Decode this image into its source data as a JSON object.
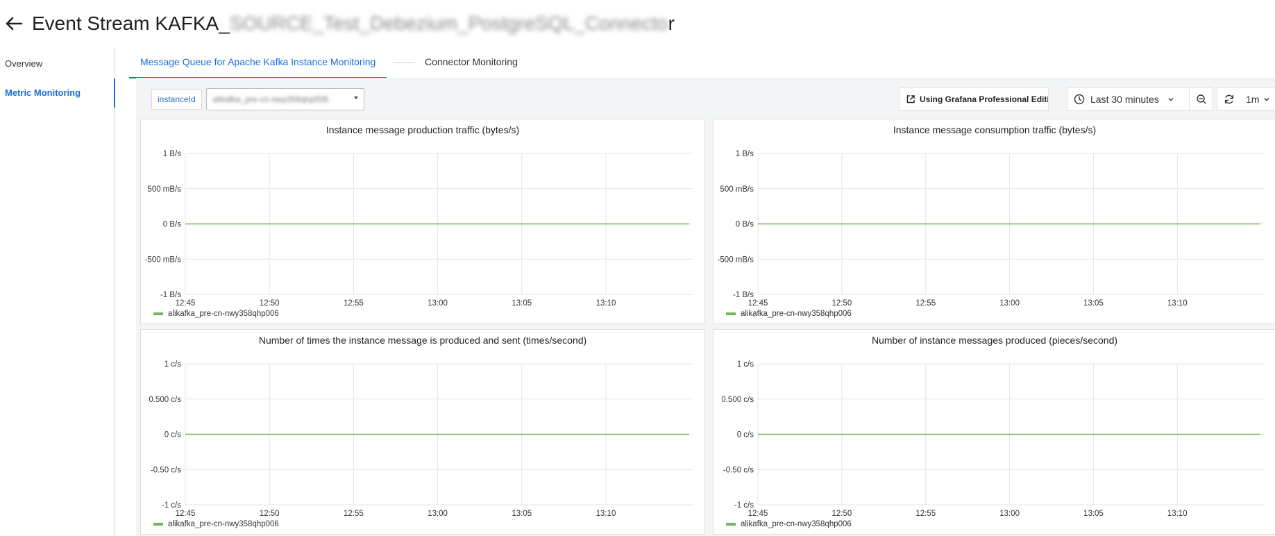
{
  "header": {
    "title_prefix": "Event Stream KAFKA_",
    "title_blurred": "SOURCE_Test_Debezium_PostgreSQL_Connecto",
    "title_suffix": "r"
  },
  "sidebar": {
    "items": [
      {
        "label": "Overview",
        "active": false
      },
      {
        "label": "Metric Monitoring",
        "active": true
      }
    ]
  },
  "tabs": [
    {
      "label": "Message Queue for Apache Kafka Instance Monitoring",
      "active": true
    },
    {
      "label": "Connector Monitoring",
      "active": false
    }
  ],
  "toolbar": {
    "variable_label": "instanceId",
    "variable_value": "alikafka_pre-cn-nwy358qhp006",
    "grafana_label": "Using Grafana Professional Edition",
    "time_range": "Last 30 minutes",
    "refresh_interval": "1m"
  },
  "colors": {
    "accent": "#1b6fd1",
    "series": "#73b359"
  },
  "icons": [
    "arrow-left-icon",
    "external-link-icon",
    "clock-icon",
    "chevron-down-icon",
    "zoom-out-icon",
    "refresh-icon"
  ],
  "chart_data": [
    {
      "type": "line",
      "title": "Instance message production traffic (bytes/s)",
      "x_ticks": [
        "12:45",
        "12:50",
        "12:55",
        "13:00",
        "13:05",
        "13:10"
      ],
      "y_ticks": [
        "1 B/s",
        "500 mB/s",
        "0 B/s",
        "-500 mB/s",
        "-1 B/s"
      ],
      "ylim": [
        -1,
        1
      ],
      "grid": true,
      "legend_position": "bottom-left",
      "series": [
        {
          "name": "alikafka_pre-cn-nwy358qhp006",
          "color": "#73b359",
          "values": [
            0,
            0,
            0,
            0,
            0,
            0,
            0
          ]
        }
      ]
    },
    {
      "type": "line",
      "title": "Instance message consumption traffic (bytes/s)",
      "x_ticks": [
        "12:45",
        "12:50",
        "12:55",
        "13:00",
        "13:05",
        "13:10"
      ],
      "y_ticks": [
        "1 B/s",
        "500 mB/s",
        "0 B/s",
        "-500 mB/s",
        "-1 B/s"
      ],
      "ylim": [
        -1,
        1
      ],
      "grid": true,
      "legend_position": "bottom-left",
      "series": [
        {
          "name": "alikafka_pre-cn-nwy358qhp006",
          "color": "#73b359",
          "values": [
            0,
            0,
            0,
            0,
            0,
            0,
            0
          ]
        }
      ]
    },
    {
      "type": "line",
      "title": "Number of times the instance message is produced and sent (times/second)",
      "x_ticks": [
        "12:45",
        "12:50",
        "12:55",
        "13:00",
        "13:05",
        "13:10"
      ],
      "y_ticks": [
        "1 c/s",
        "0.500 c/s",
        "0 c/s",
        "-0.50 c/s",
        "-1 c/s"
      ],
      "ylim": [
        -1,
        1
      ],
      "grid": true,
      "legend_position": "bottom-left",
      "series": [
        {
          "name": "alikafka_pre-cn-nwy358qhp006",
          "color": "#73b359",
          "values": [
            0,
            0,
            0,
            0,
            0,
            0,
            0
          ]
        }
      ]
    },
    {
      "type": "line",
      "title": "Number of instance messages produced (pieces/second)",
      "x_ticks": [
        "12:45",
        "12:50",
        "12:55",
        "13:00",
        "13:05",
        "13:10"
      ],
      "y_ticks": [
        "1 c/s",
        "0.500 c/s",
        "0 c/s",
        "-0.50 c/s",
        "-1 c/s"
      ],
      "ylim": [
        -1,
        1
      ],
      "grid": true,
      "legend_position": "bottom-left",
      "series": [
        {
          "name": "alikafka_pre-cn-nwy358qhp006",
          "color": "#73b359",
          "values": [
            0,
            0,
            0,
            0,
            0,
            0,
            0
          ]
        }
      ]
    }
  ]
}
